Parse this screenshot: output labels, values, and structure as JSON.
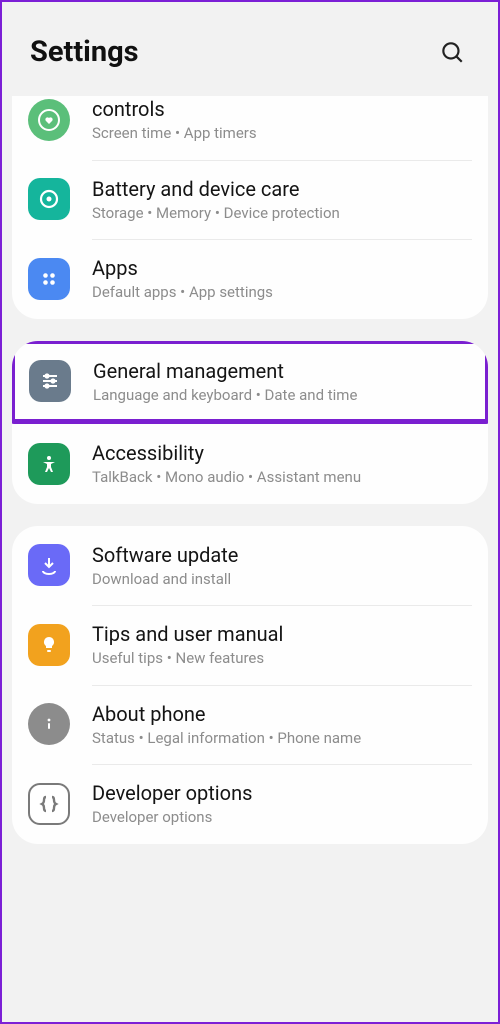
{
  "header": {
    "title": "Settings"
  },
  "groups": [
    {
      "items": [
        {
          "title": "controls",
          "subtitle": "Screen time  •  App timers",
          "icon": "heart-circle",
          "color": "#5bbf7a"
        },
        {
          "title": "Battery and device care",
          "subtitle": "Storage  •  Memory  •  Device protection",
          "icon": "refresh-dot",
          "color": "#15b59c"
        },
        {
          "title": "Apps",
          "subtitle": "Default apps  •  App settings",
          "icon": "grid4",
          "color": "#4b89f2"
        }
      ]
    },
    {
      "items": [
        {
          "title": "General management",
          "subtitle": "Language and keyboard  •  Date and time",
          "icon": "sliders",
          "color": "#6a7b8c",
          "highlight": true
        },
        {
          "title": "Accessibility",
          "subtitle": "TalkBack  •  Mono audio  •  Assistant menu",
          "icon": "person",
          "color": "#1e9a5a"
        }
      ]
    },
    {
      "items": [
        {
          "title": "Software update",
          "subtitle": "Download and install",
          "icon": "download",
          "color": "#6a6af7"
        },
        {
          "title": "Tips and user manual",
          "subtitle": "Useful tips  •  New features",
          "icon": "bulb",
          "color": "#f2a21e"
        },
        {
          "title": "About phone",
          "subtitle": "Status  •  Legal information  •  Phone name",
          "icon": "info",
          "color": "#8c8c8c"
        },
        {
          "title": "Developer options",
          "subtitle": "Developer options",
          "icon": "braces",
          "color": "#7a7a7a"
        }
      ]
    }
  ]
}
